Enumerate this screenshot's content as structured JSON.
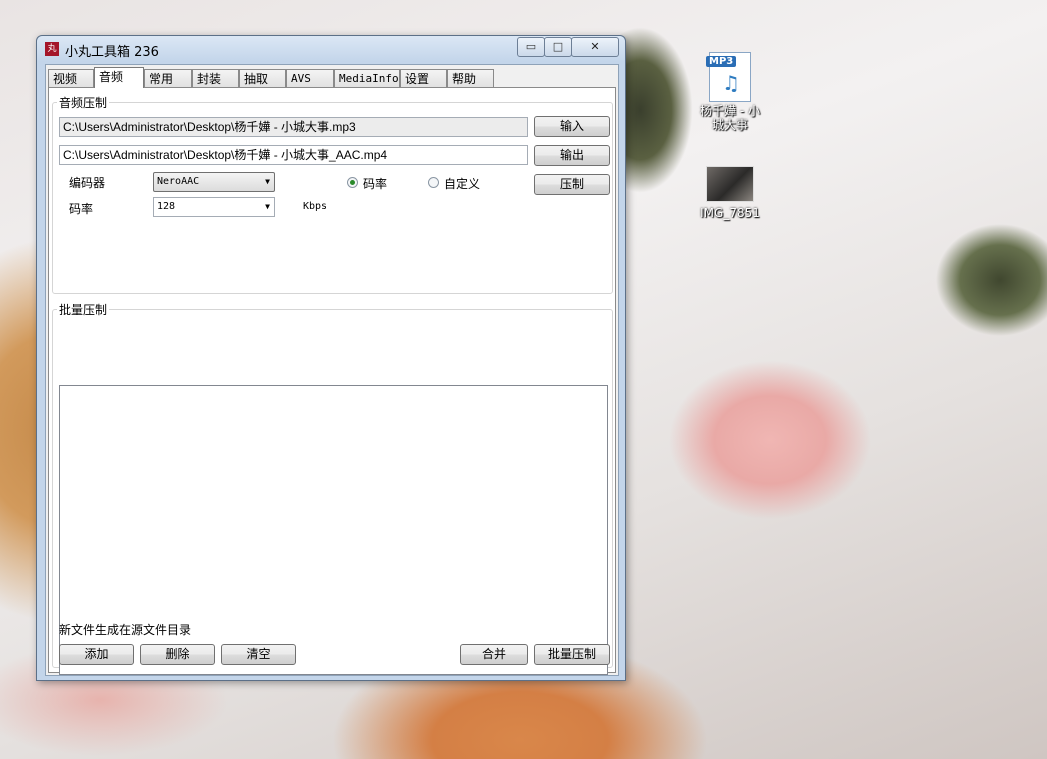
{
  "window": {
    "title": "小丸工具箱 236",
    "controls": {
      "minimize": "▭",
      "maximize": "□",
      "close": "✕"
    }
  },
  "tabs": [
    {
      "label": "视频",
      "active": false
    },
    {
      "label": "音频",
      "active": true
    },
    {
      "label": "常用",
      "active": false
    },
    {
      "label": "封装",
      "active": false
    },
    {
      "label": "抽取",
      "active": false
    },
    {
      "label": "AVS",
      "active": false
    },
    {
      "label": "MediaInfo",
      "active": false
    },
    {
      "label": "设置",
      "active": false
    },
    {
      "label": "帮助",
      "active": false
    }
  ],
  "audio_group": {
    "label": "音频压制",
    "input_path": "C:\\Users\\Administrator\\Desktop\\杨千嬅 - 小城大事.mp3",
    "output_path": "C:\\Users\\Administrator\\Desktop\\杨千嬅 - 小城大事_AAC.mp4",
    "input_button": "输入",
    "output_button": "输出",
    "encode_button": "压制",
    "encoder_label": "编码器",
    "encoder_value": "NeroAAC",
    "bitrate_label": "码率",
    "bitrate_value": "128",
    "bitrate_unit": "Kbps",
    "mode_options": [
      {
        "label": "码率",
        "selected": true
      },
      {
        "label": "自定义",
        "selected": false
      }
    ]
  },
  "batch_group": {
    "label": "批量压制",
    "items": [],
    "note": "新文件生成在源文件目录",
    "add_button": "添加",
    "delete_button": "删除",
    "clear_button": "清空",
    "merge_button": "合并",
    "batch_encode_button": "批量压制"
  },
  "desktop_icons": [
    {
      "label": "杨千嬅 - 小城大事",
      "badge": "MP3",
      "icon": "mp3-file-icon"
    },
    {
      "label": "IMG_7851",
      "icon": "image-thumbnail-icon"
    }
  ],
  "colors": {
    "title_bar": "#c3d5ea",
    "app_icon": "#a4162a",
    "radio_selected": "#2a8a2a"
  }
}
